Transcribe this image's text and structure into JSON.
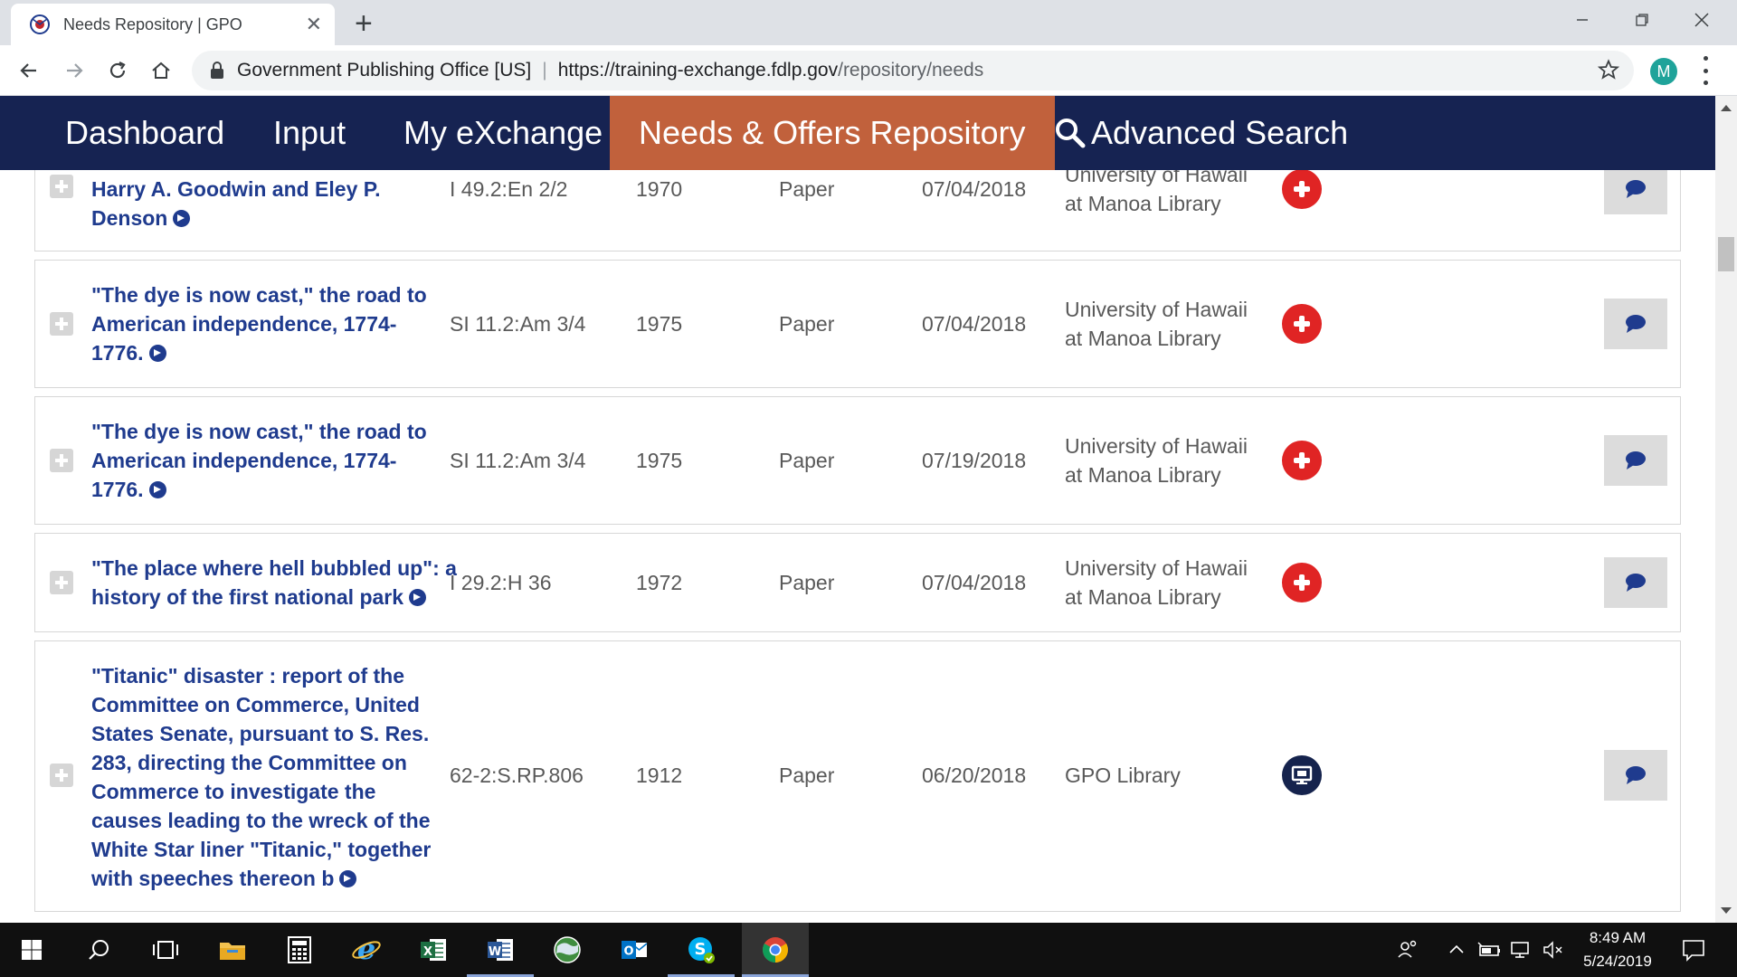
{
  "browser": {
    "tab_title": "Needs Repository | GPO",
    "site_name": "Government Publishing Office [US]",
    "url_host": "https://training-exchange.fdlp.gov",
    "url_path": "/repository/needs",
    "profile_initial": "M"
  },
  "nav": {
    "items": [
      "Dashboard",
      "Input",
      "My eXchange",
      "Needs & Offers Repository"
    ],
    "search_label": "Advanced Search",
    "active": "Needs & Offers Repository"
  },
  "rows": [
    {
      "title": "Harry A. Goodwin and Eley P. Denson",
      "sudoc": "I 49.2:En 2/2",
      "year": "1970",
      "format": "Paper",
      "date": "07/04/2018",
      "library": "University of Hawaii at Manoa Library",
      "type_icon": "red-cross-icon"
    },
    {
      "title": "\"The dye is now cast,\" the road to American independence, 1774-1776.",
      "sudoc": "SI 11.2:Am 3/4",
      "year": "1975",
      "format": "Paper",
      "date": "07/04/2018",
      "library": "University of Hawaii at Manoa Library",
      "type_icon": "red-cross-icon"
    },
    {
      "title": "\"The dye is now cast,\" the road to American independence, 1774-1776.",
      "sudoc": "SI 11.2:Am 3/4",
      "year": "1975",
      "format": "Paper",
      "date": "07/19/2018",
      "library": "University of Hawaii at Manoa Library",
      "type_icon": "red-cross-icon"
    },
    {
      "title": "\"The place where hell bubbled up\": a history of the first national park",
      "sudoc": "I 29.2:H 36",
      "year": "1972",
      "format": "Paper",
      "date": "07/04/2018",
      "library": "University of Hawaii at Manoa Library",
      "type_icon": "red-cross-icon"
    },
    {
      "title": "\"Titanic\" disaster : report of the Committee on Commerce, United States Senate, pursuant to S. Res. 283, directing the Committee on Commerce to investigate the causes leading to the wreck of the White Star liner \"Titanic,\" together with speeches thereon b",
      "sudoc": "62-2:S.RP.806",
      "year": "1912",
      "format": "Paper",
      "date": "06/20/2018",
      "library": "GPO Library",
      "type_icon": "monitor-icon"
    }
  ],
  "taskbar": {
    "time": "8:49 AM",
    "date": "5/24/2019"
  },
  "colors": {
    "nav_bg": "#162352",
    "nav_active": "#c1613c",
    "link": "#1f3b8e",
    "need_icon": "#e02424"
  }
}
